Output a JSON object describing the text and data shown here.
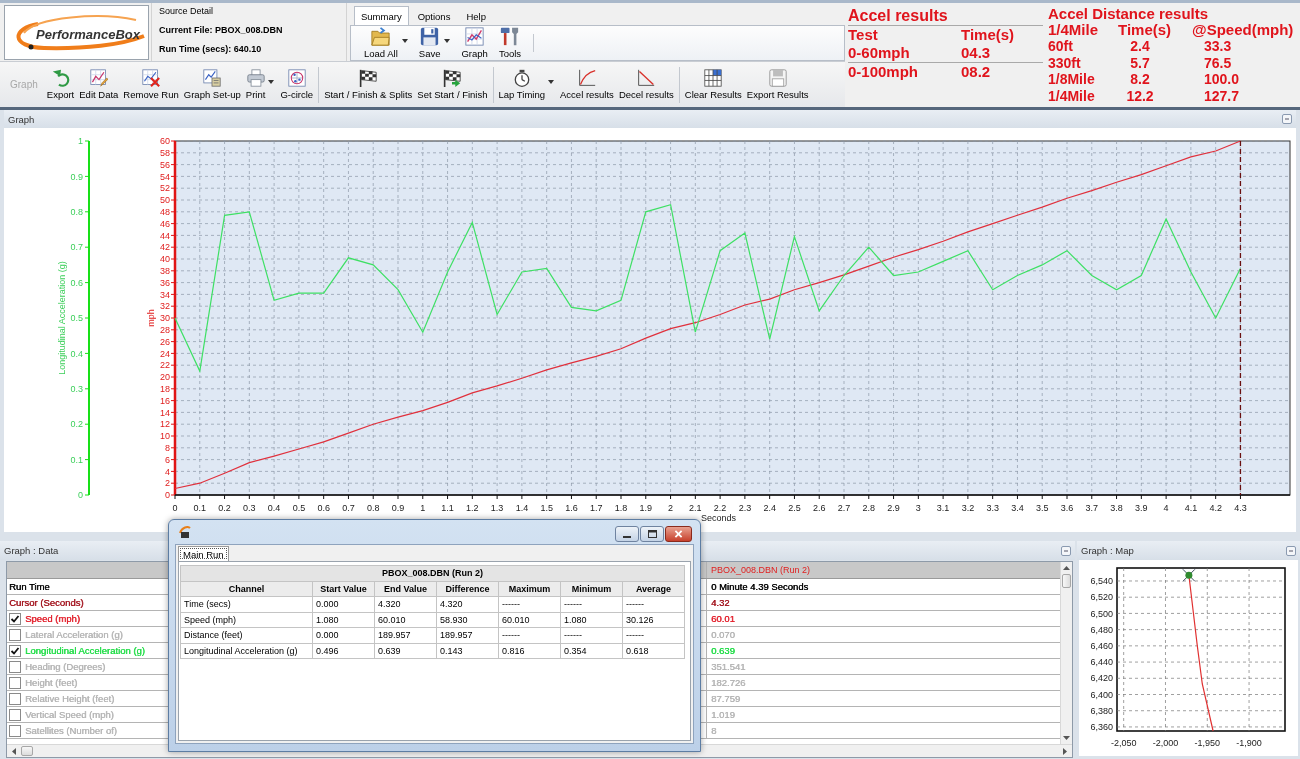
{
  "logo": {
    "text": "PerformanceBox"
  },
  "source_detail": {
    "title": "Source Detail",
    "current_file": "Current File: PBOX_008.DBN",
    "run_time": "Run Time (secs): 640.10"
  },
  "ribbon": {
    "tabs": [
      {
        "label": "Summary",
        "selected": true
      },
      {
        "label": "Options",
        "selected": false
      },
      {
        "label": "Help",
        "selected": false
      }
    ],
    "buttons": [
      {
        "label": "Load All",
        "dropdown": true
      },
      {
        "label": "Save",
        "dropdown": true
      },
      {
        "label": "Graph",
        "dropdown": false
      },
      {
        "label": "Tools",
        "dropdown": false
      }
    ]
  },
  "toolbar": {
    "title": "Graph",
    "groups": [
      {
        "buttons": [
          {
            "label": "Export",
            "dropdown": false
          },
          {
            "label": "Edit Data",
            "dropdown": false
          },
          {
            "label": "Remove Run",
            "dropdown": false
          },
          {
            "label": "Graph Set-up",
            "dropdown": false
          },
          {
            "label": "Print",
            "dropdown": true
          },
          {
            "label": "G-circle",
            "dropdown": false
          }
        ]
      },
      {
        "buttons": [
          {
            "label": "Start / Finish & Splits",
            "dropdown": false
          },
          {
            "label": "Set Start / Finish",
            "dropdown": false
          }
        ]
      },
      {
        "buttons": [
          {
            "label": "Lap Timing",
            "dropdown": true
          },
          {
            "label": "Accel results",
            "dropdown": false
          },
          {
            "label": "Decel results",
            "dropdown": false
          }
        ]
      },
      {
        "buttons": [
          {
            "label": "Clear Results",
            "dropdown": false
          },
          {
            "label": "Export Results",
            "dropdown": false
          }
        ]
      }
    ]
  },
  "accel_results": {
    "title": "Accel results",
    "columns": [
      "Test",
      "Time(s)"
    ],
    "rows": [
      [
        "0-60mph",
        "04.3"
      ],
      [
        "0-100mph",
        "08.2"
      ]
    ]
  },
  "accel_distance_results": {
    "title": "Accel Distance results",
    "columns": [
      "1/4Mile",
      "Time(s)",
      "@Speed(mph)"
    ],
    "rows": [
      [
        "60ft",
        "2.4",
        "33.3"
      ],
      [
        "330ft",
        "5.7",
        "76.5"
      ],
      [
        "1/8Mile",
        "8.2",
        "100.0"
      ],
      [
        "1/4Mile",
        "12.2",
        "127.7"
      ]
    ]
  },
  "graph": {
    "title": "Graph",
    "chart_data": {
      "type": "line",
      "xlabel": "Seconds",
      "ylabel": "mph",
      "y2label": "Longitudinal Acceleration (g)",
      "x": [
        0,
        0.1,
        0.2,
        0.3,
        0.4,
        0.5,
        0.6,
        0.7,
        0.8,
        0.9,
        1,
        1.1,
        1.2,
        1.3,
        1.4,
        1.5,
        1.6,
        1.7,
        1.8,
        1.9,
        2,
        2.1,
        2.2,
        2.3,
        2.4,
        2.5,
        2.6,
        2.7,
        2.8,
        2.9,
        3,
        3.1,
        3.2,
        3.3,
        3.4,
        3.5,
        3.6,
        3.7,
        3.8,
        3.9,
        4,
        4.1,
        4.2,
        4.3
      ],
      "series": [
        {
          "color": "#e0303c",
          "values": [
            1.1,
            2.0,
            3.7,
            5.5,
            6.6,
            7.8,
            9.0,
            10.5,
            12.0,
            13.2,
            14.3,
            15.7,
            17.3,
            18.5,
            19.8,
            21.2,
            22.4,
            23.5,
            24.8,
            26.6,
            28.2,
            29.2,
            30.6,
            32.2,
            33.2,
            34.8,
            36.0,
            37.3,
            38.8,
            40.3,
            41.6,
            43.0,
            44.6,
            46.0,
            47.4,
            48.8,
            50.3,
            51.6,
            53.0,
            54.3,
            55.8,
            57.3,
            58.3,
            60.0
          ]
        },
        {
          "color": "#3ee064",
          "axis": "y2",
          "values": [
            0.5,
            0.35,
            0.79,
            0.8,
            0.55,
            0.57,
            0.57,
            0.67,
            0.65,
            0.58,
            0.46,
            0.63,
            0.77,
            0.51,
            0.63,
            0.64,
            0.53,
            0.52,
            0.55,
            0.8,
            0.82,
            0.46,
            0.69,
            0.74,
            0.44,
            0.73,
            0.52,
            0.62,
            0.7,
            0.62,
            0.63,
            0.66,
            0.69,
            0.58,
            0.62,
            0.65,
            0.69,
            0.62,
            0.58,
            0.62,
            0.78,
            0.63,
            0.5,
            0.64
          ]
        }
      ],
      "xlim": [
        0,
        4.5
      ],
      "ylim": [
        0,
        60
      ],
      "y2lim": [
        0,
        1
      ],
      "xticks": [
        0,
        0.1,
        0.2,
        0.3,
        0.4,
        0.5,
        0.6,
        0.7,
        0.8,
        0.9,
        1,
        1.1,
        1.2,
        1.3,
        1.4,
        1.5,
        1.6,
        1.7,
        1.8,
        1.9,
        2,
        2.1,
        2.2,
        2.3,
        2.4,
        2.5,
        2.6,
        2.7,
        2.8,
        2.9,
        3,
        3.1,
        3.2,
        3.3,
        3.4,
        3.5,
        3.6,
        3.7,
        3.8,
        3.9,
        4,
        4.1,
        4.2,
        4.3
      ],
      "yticks": [
        0,
        2,
        4,
        6,
        8,
        10,
        12,
        14,
        16,
        18,
        20,
        22,
        24,
        26,
        28,
        30,
        32,
        34,
        36,
        38,
        40,
        42,
        44,
        46,
        48,
        50,
        52,
        54,
        56,
        58,
        60
      ],
      "y2ticks": [
        0,
        0.1,
        0.2,
        0.3,
        0.4,
        0.5,
        0.6,
        0.7,
        0.8,
        0.9,
        1
      ],
      "grid": true,
      "ref_lines": [
        {
          "axis": "x",
          "value": 4.3
        }
      ]
    }
  },
  "data_panel": {
    "title": "Graph : Data",
    "column_header": "PBOX_008.DBN (Run 2)",
    "rows": [
      {
        "kind": "info",
        "label": "Run Time",
        "value": "0 Minute 4.39 Seconds",
        "color": "#000000"
      },
      {
        "kind": "info",
        "label": "Cursor (Seconds)",
        "value": "4.32",
        "color": "#a3141e"
      },
      {
        "kind": "channel",
        "label": "Speed (mph)",
        "value": "60.01",
        "checked": true,
        "color": "#e3202c"
      },
      {
        "kind": "channel",
        "label": "Lateral Acceleration (g)",
        "value": "0.070",
        "checked": false
      },
      {
        "kind": "channel",
        "label": "Longitudinal Acceleration (g)",
        "value": "0.639",
        "checked": true,
        "color": "#22dd48"
      },
      {
        "kind": "channel",
        "label": "Heading (Degrees)",
        "value": "351.541",
        "checked": false
      },
      {
        "kind": "channel",
        "label": "Height (feet)",
        "value": "182.726",
        "checked": false
      },
      {
        "kind": "channel",
        "label": "Relative Height (feet)",
        "value": "87.759",
        "checked": false
      },
      {
        "kind": "channel",
        "label": "Vertical Speed (mph)",
        "value": "1.019",
        "checked": false
      },
      {
        "kind": "channel",
        "label": "Satellites (Number of)",
        "value": "8",
        "checked": false
      }
    ]
  },
  "map": {
    "title": "Graph : Map",
    "chart_data": {
      "type": "line",
      "x": [
        -1972,
        -1962,
        -1956,
        -1943
      ],
      "series": [
        {
          "color": "#e03030",
          "values": [
            6547,
            6461,
            6413,
            6355
          ]
        }
      ],
      "xlim": [
        -2058,
        -1857
      ],
      "ylim": [
        6355,
        6556
      ],
      "xticks": [
        {
          "value": -2050,
          "label": "-2,050"
        },
        {
          "value": -2000,
          "label": "-2,000"
        },
        {
          "value": -1950,
          "label": "-1,950"
        },
        {
          "value": -1900,
          "label": "-1,900"
        }
      ],
      "yticks": [
        {
          "value": 6360,
          "label": "6,360"
        },
        {
          "value": 6380,
          "label": "6,380"
        },
        {
          "value": 6400,
          "label": "6,400"
        },
        {
          "value": 6420,
          "label": "6,420"
        },
        {
          "value": 6440,
          "label": "6,440"
        },
        {
          "value": 6460,
          "label": "6,460"
        },
        {
          "value": 6480,
          "label": "6,480"
        },
        {
          "value": 6500,
          "label": "6,500"
        },
        {
          "value": 6520,
          "label": "6,520"
        },
        {
          "value": 6540,
          "label": "6,540"
        }
      ],
      "grid": true
    }
  },
  "popup": {
    "tabs": [
      {
        "label": "Main Run",
        "selected": true
      }
    ],
    "table": {
      "title": "PBOX_008.DBN (Run 2)",
      "columns": [
        "Channel",
        "Start Value",
        "End Value",
        "Difference",
        "Maximum",
        "Minimum",
        "Average"
      ],
      "rows": [
        [
          "Time (secs)",
          "0.000",
          "4.320",
          "4.320",
          "------",
          "------",
          "------"
        ],
        [
          "Speed (mph)",
          "1.080",
          "60.010",
          "58.930",
          "60.010",
          "1.080",
          "30.126"
        ],
        [
          "Distance (feet)",
          "0.000",
          "189.957",
          "189.957",
          "------",
          "------",
          "------"
        ],
        [
          "Longitudinal Acceleration (g)",
          "0.496",
          "0.639",
          "0.143",
          "0.816",
          "0.354",
          "0.618"
        ]
      ]
    }
  }
}
